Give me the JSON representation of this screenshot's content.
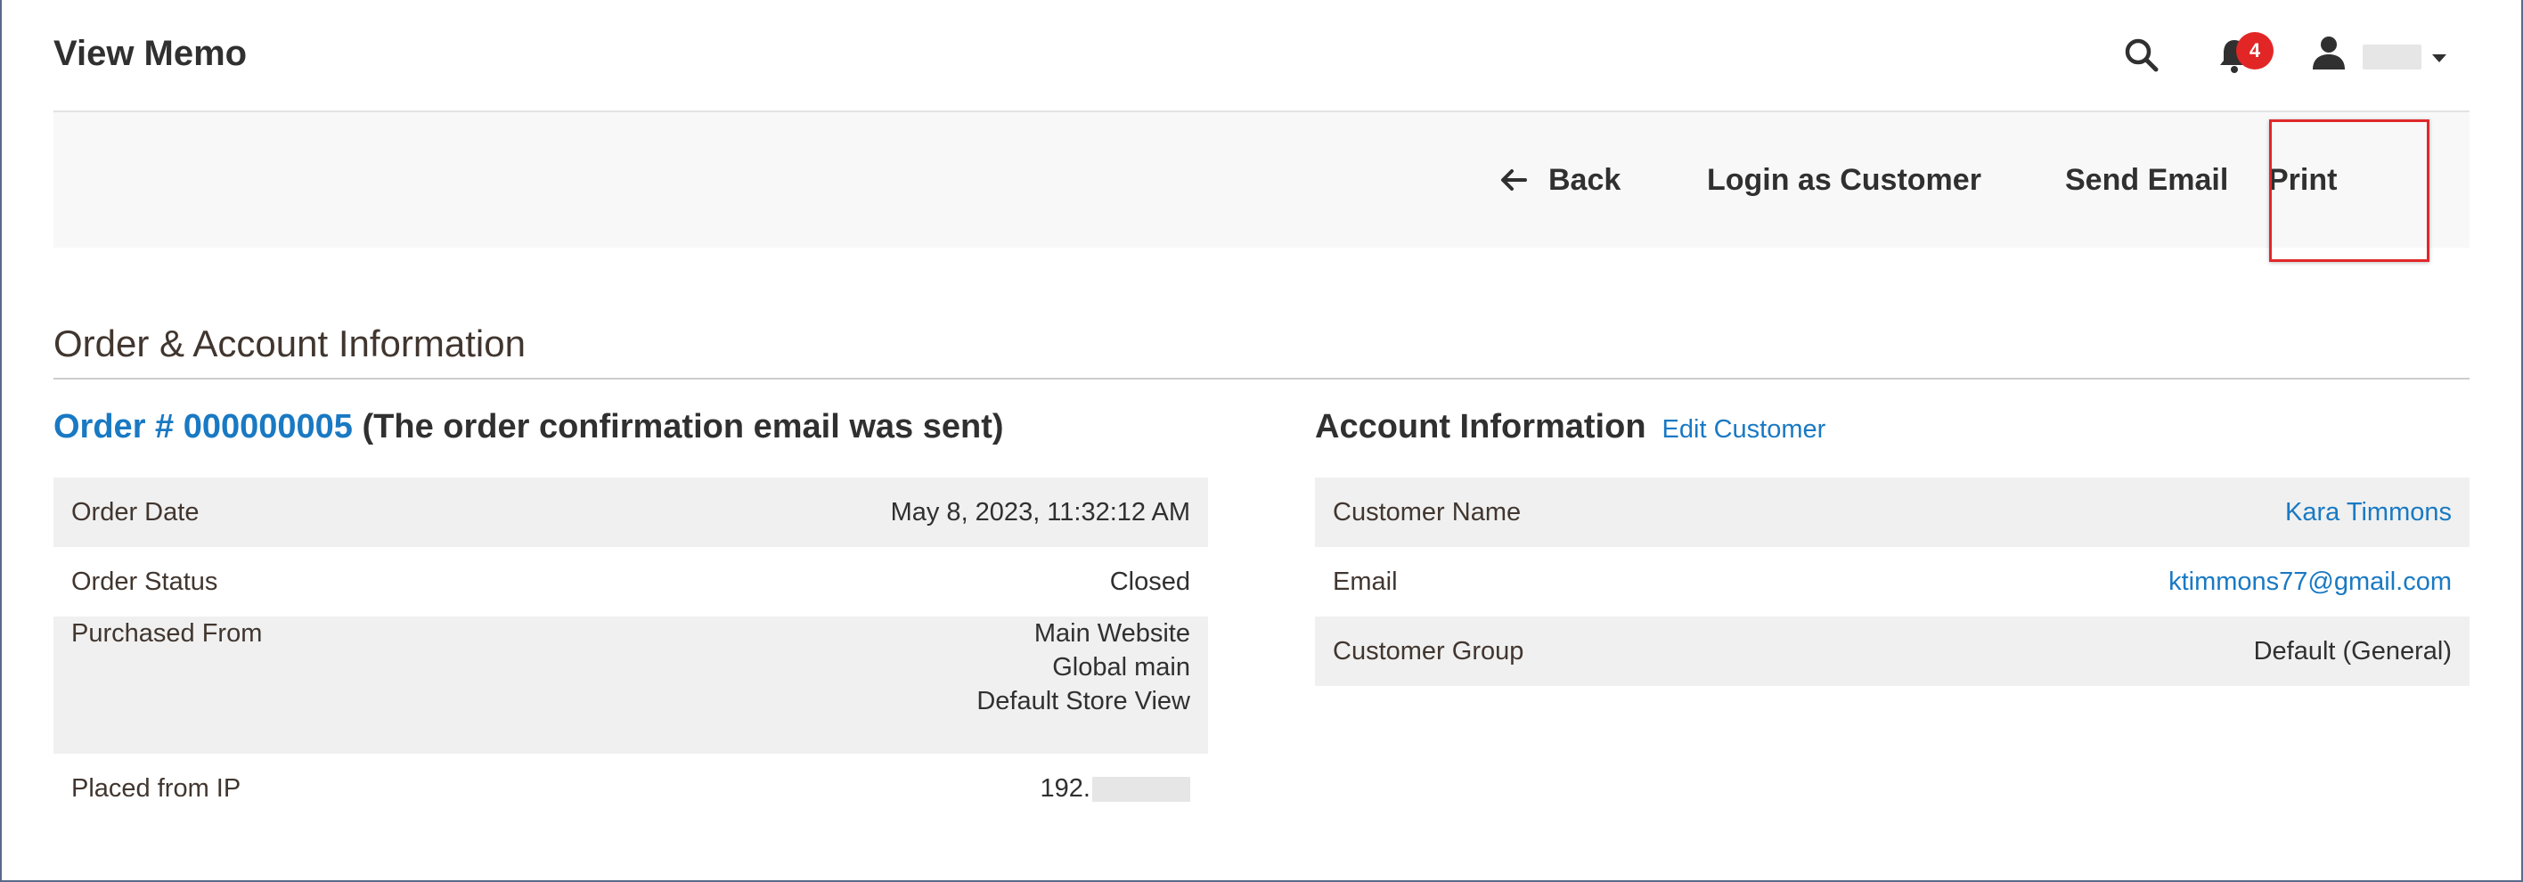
{
  "header": {
    "title": "View Memo",
    "notifications_count": "4"
  },
  "actions": {
    "back": "Back",
    "login_as_customer": "Login as Customer",
    "send_email": "Send Email",
    "print": "Print"
  },
  "section": {
    "title": "Order & Account Information"
  },
  "order": {
    "link": "Order # 000000005",
    "note": " (The order confirmation email was sent)",
    "rows": [
      {
        "label": "Order Date",
        "value": "May 8, 2023, 11:32:12 AM"
      },
      {
        "label": "Order Status",
        "value": "Closed"
      },
      {
        "label": "Purchased From",
        "lines": [
          "Main Website",
          "Global main",
          "Default Store View"
        ]
      },
      {
        "label": "Placed from IP",
        "value": "192."
      }
    ]
  },
  "account": {
    "title": "Account Information",
    "edit_link": "Edit Customer",
    "rows": [
      {
        "label": "Customer Name",
        "value": "Kara Timmons"
      },
      {
        "label": "Email",
        "value": "ktimmons77@gmail.com"
      },
      {
        "label": "Customer Group",
        "value": "Default (General)"
      }
    ]
  },
  "colors": {
    "link": "#1979c3",
    "badge": "#e22626",
    "highlight": "#e0282a"
  }
}
